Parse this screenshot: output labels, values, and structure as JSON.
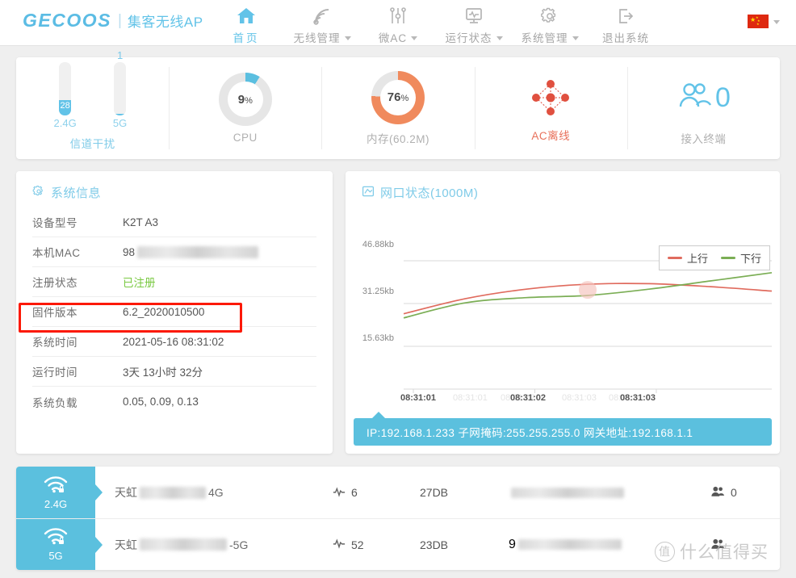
{
  "header": {
    "logo": "GECOOS",
    "separator": "|",
    "subtitle": "集客无线AP",
    "nav": [
      {
        "label": "首页",
        "icon": "home-icon",
        "active": true,
        "has_caret": false
      },
      {
        "label": "无线管理",
        "icon": "wifi-icon",
        "active": false,
        "has_caret": true
      },
      {
        "label": "微AC",
        "icon": "sliders-icon",
        "active": false,
        "has_caret": true
      },
      {
        "label": "运行状态",
        "icon": "monitor-pulse-icon",
        "active": false,
        "has_caret": true
      },
      {
        "label": "系统管理",
        "icon": "gear-icon",
        "active": false,
        "has_caret": true
      },
      {
        "label": "退出系统",
        "icon": "logout-icon",
        "active": false,
        "has_caret": false
      }
    ],
    "language": {
      "icon": "china-flag-icon",
      "caret": "chevron-down-icon"
    }
  },
  "stats": {
    "interference": {
      "caption": "信道干扰",
      "bars": [
        {
          "band": "2.4G",
          "value": "28",
          "percent": 28,
          "value_inside": true
        },
        {
          "band": "5G",
          "value": "1",
          "percent": 2,
          "value_inside": false
        }
      ]
    },
    "cpu": {
      "value": "9",
      "unit": "%",
      "caption": "CPU",
      "percent": 9,
      "color": "#5bbfe0"
    },
    "memory": {
      "value": "76",
      "unit": "%",
      "caption": "内存(60.2M)",
      "percent": 76,
      "color": "#f08a5d"
    },
    "ac": {
      "caption": "AC离线",
      "icon": "network-nodes-icon",
      "color": "#e0503f"
    },
    "terminals": {
      "count": "0",
      "caption": "接入终端",
      "icon": "users-icon",
      "color": "#62c3e8"
    }
  },
  "system_info": {
    "title": "系统信息",
    "icon": "gear-icon",
    "rows": [
      {
        "key": "设备型号",
        "value": "K2T A3",
        "masked": false,
        "green": false
      },
      {
        "key": "本机MAC",
        "value": "98",
        "masked": true,
        "green": false
      },
      {
        "key": "注册状态",
        "value": "已注册",
        "masked": false,
        "green": true
      },
      {
        "key": "固件版本",
        "value": "6.2_2020010500",
        "masked": false,
        "green": false
      },
      {
        "key": "系统时间",
        "value": "2021-05-16 08:31:02",
        "masked": false,
        "green": false
      },
      {
        "key": "运行时间",
        "value": "3天 13小时 32分",
        "masked": false,
        "green": false
      },
      {
        "key": "系统负载",
        "value": "0.05, 0.09, 0.13",
        "masked": false,
        "green": false
      }
    ],
    "highlight": {
      "row_key": "固件版本",
      "color": "#fc1905"
    }
  },
  "net_panel": {
    "title": "网口状态(1000M)",
    "icon": "port-icon",
    "ip_bar": "IP:192.168.1.233  子网掩码:255.255.255.0  网关地址:192.168.1.1"
  },
  "chart_data": {
    "type": "line",
    "title": "网口状态(1000M)",
    "xlabel": "",
    "ylabel": "",
    "ylim": [
      0,
      62.5
    ],
    "yticks": [
      "15.63kb",
      "31.25kb",
      "46.88kb"
    ],
    "ytick_values": [
      15.63,
      31.25,
      46.88
    ],
    "grid": true,
    "legend_position": "top-right",
    "x": [
      "08:31:01",
      "08:31:01",
      "08:31:02",
      "08:31:02",
      "08:31:03"
    ],
    "xticks_dark": [
      "08:31:01",
      "08:31:02",
      "08:31:03"
    ],
    "xticks_ghost": [
      "08:31:01",
      "08:31:02",
      "08:31:03"
    ],
    "series": [
      {
        "name": "上行",
        "color": "#e06b5e",
        "values": [
          27.5,
          33.0,
          36.5,
          38.3,
          38.5,
          37.4,
          35.8
        ]
      },
      {
        "name": "下行",
        "color": "#7bae55",
        "values": [
          26.0,
          31.5,
          33.4,
          34.2,
          36.5,
          39.5,
          42.5
        ]
      }
    ],
    "highlight_point": {
      "series": "上行",
      "x_index": 3,
      "color": "#f4c2bb"
    }
  },
  "ssid_list": [
    {
      "band": "2.4G",
      "icon": "wifi-lock-icon",
      "name_prefix": "天虹",
      "name_suffix": "4G",
      "name_masked": true,
      "channel_icon": "signal-icon",
      "channel": "6",
      "power": "27DB",
      "mac_masked": true,
      "mac_prefix": "",
      "users_icon": "user-icon",
      "users": "0"
    },
    {
      "band": "5G",
      "icon": "wifi-lock-icon",
      "name_prefix": "天虹",
      "name_suffix": "-5G",
      "name_masked": true,
      "channel_icon": "signal-icon",
      "channel": "52",
      "power": "23DB",
      "mac_masked": true,
      "mac_prefix": "9",
      "users_icon": "user-icon",
      "users": ""
    }
  ],
  "watermark": {
    "mark": "值",
    "text": "什么值得买"
  }
}
